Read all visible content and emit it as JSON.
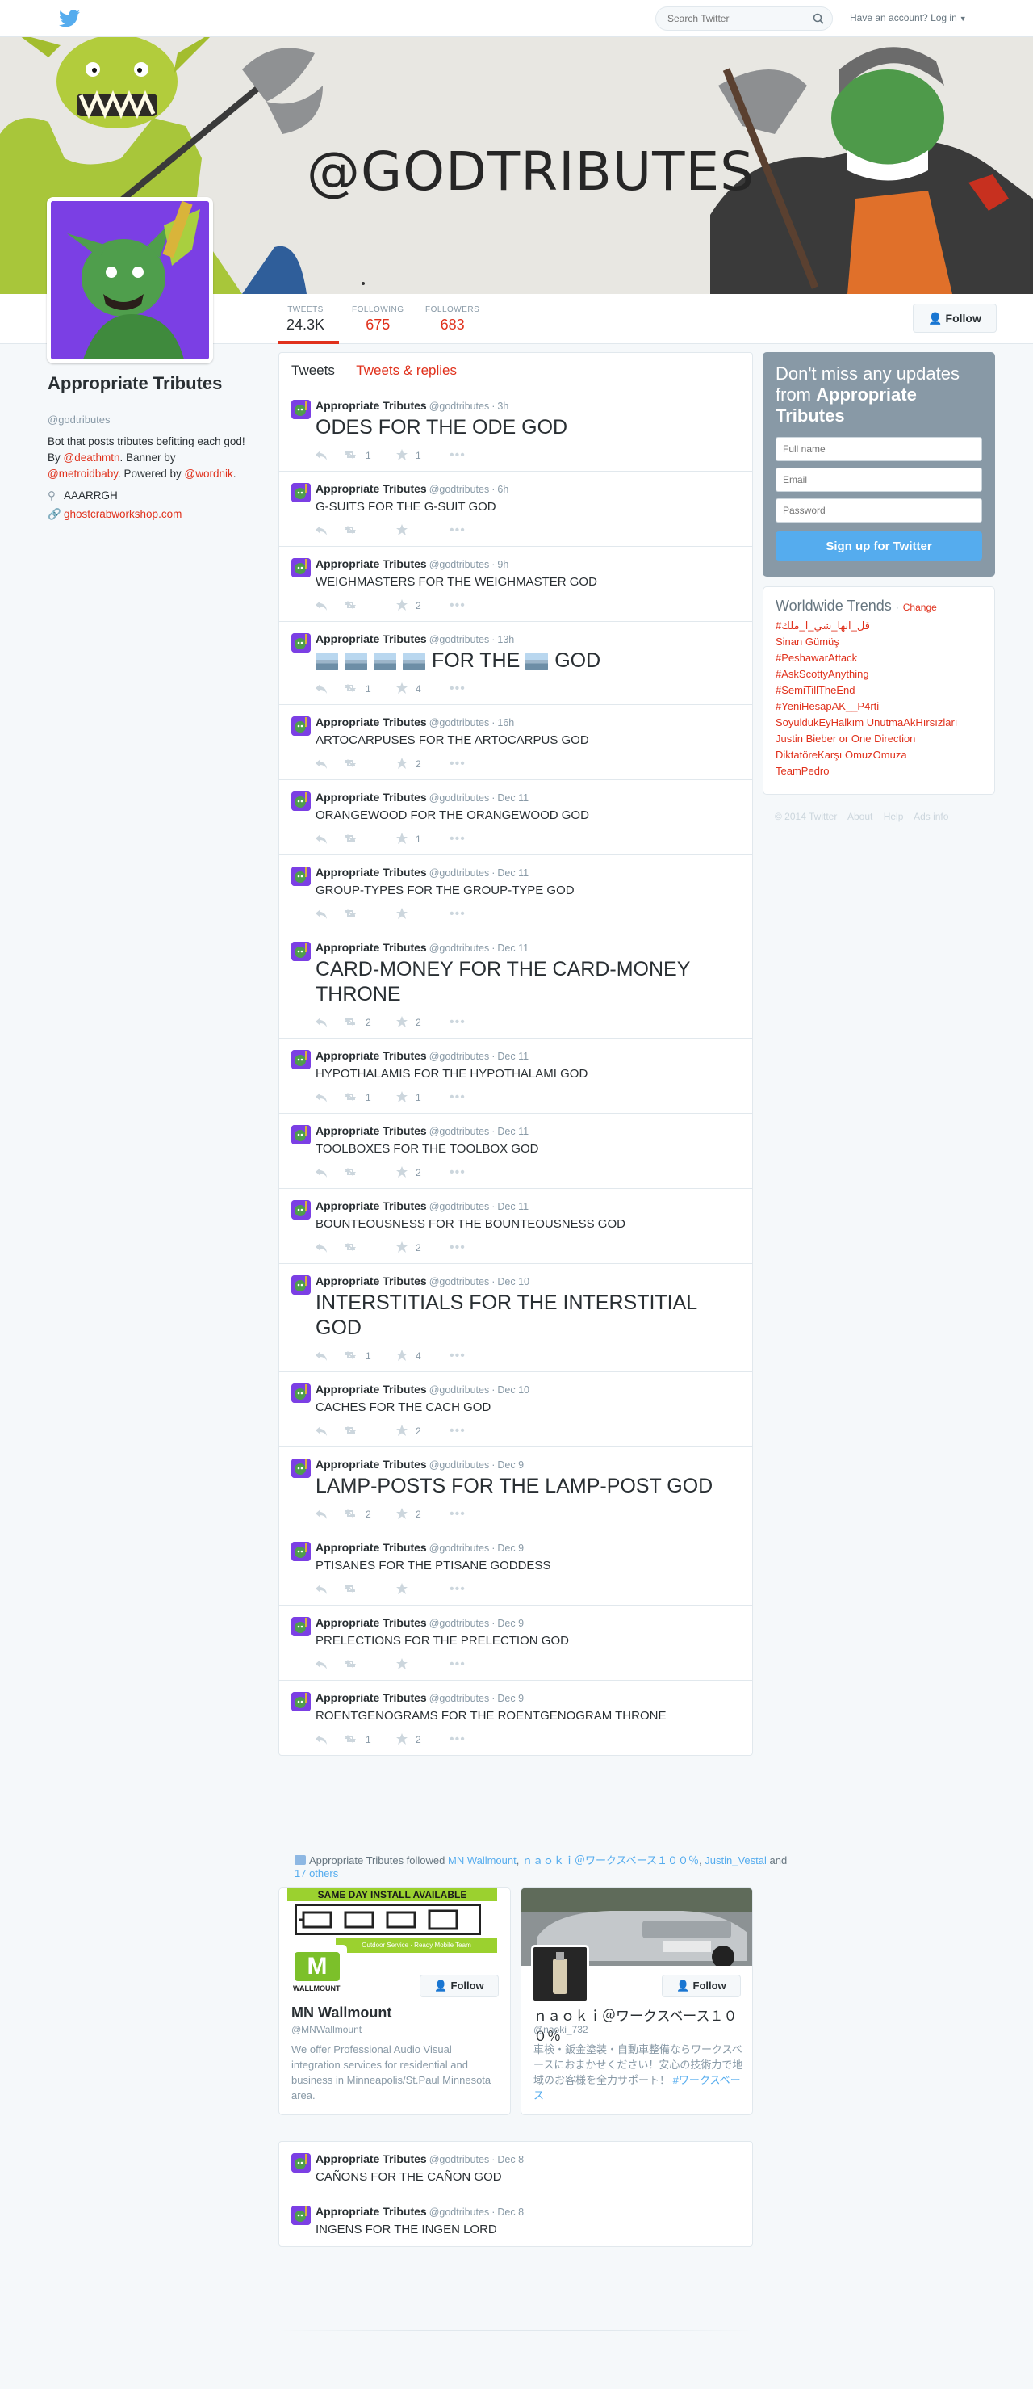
{
  "topbar": {
    "search_placeholder": "Search Twitter",
    "login_label": "Have an account? Log in"
  },
  "banner": {
    "text": "@GODTRIBUTES"
  },
  "stats": [
    {
      "label": "TWEETS",
      "value": "24.3K"
    },
    {
      "label": "FOLLOWING",
      "value": "675"
    },
    {
      "label": "FOLLOWERS",
      "value": "683"
    }
  ],
  "follow_label": "Follow",
  "profile": {
    "name": "Appropriate Tributes",
    "handle": "@godtributes",
    "bio_1": "Bot that posts tributes befitting each god! By ",
    "bio_link_1": "@deathmtn",
    "bio_2": ". Banner by ",
    "bio_link_2": "@metroidbaby",
    "bio_3": ". Powered by ",
    "bio_link_3": "@wordnik",
    "bio_4": ".",
    "location": "AAARRGH",
    "website": "ghostcrabworkshop.com"
  },
  "tabs": {
    "tweets": "Tweets",
    "replies": "Tweets & replies"
  },
  "tweets": [
    {
      "name": "Appropriate Tributes",
      "handle": "@godtributes",
      "time": "3h",
      "text": "ODES FOR THE ODE GOD",
      "retweets": "1",
      "favorites": "1"
    },
    {
      "name": "Appropriate Tributes",
      "handle": "@godtributes",
      "time": "6h",
      "text": "G-SUITS FOR THE G-SUIT GOD",
      "retweets": "",
      "favorites": ""
    },
    {
      "name": "Appropriate Tributes",
      "handle": "@godtributes",
      "time": "9h",
      "text": "WEIGHMASTERS FOR THE WEIGHMASTER GOD",
      "retweets": "",
      "favorites": "2"
    },
    {
      "name": "Appropriate Tributes",
      "handle": "@godtributes",
      "time": "13h",
      "text_1": "FOR THE",
      "text_2": "GOD",
      "retweets": "1",
      "favorites": "4"
    },
    {
      "name": "Appropriate Tributes",
      "handle": "@godtributes",
      "time": "16h",
      "text": "ARTOCARPUSES FOR THE ARTOCARPUS GOD",
      "retweets": "",
      "favorites": "2"
    },
    {
      "name": "Appropriate Tributes",
      "handle": "@godtributes",
      "time": "Dec 11",
      "text": "ORANGEWOOD FOR THE ORANGEWOOD GOD",
      "retweets": "",
      "favorites": "1"
    },
    {
      "name": "Appropriate Tributes",
      "handle": "@godtributes",
      "time": "Dec 11",
      "text": "GROUP-TYPES FOR THE GROUP-TYPE GOD",
      "retweets": "",
      "favorites": ""
    },
    {
      "name": "Appropriate Tributes",
      "handle": "@godtributes",
      "time": "Dec 11",
      "text": "CARD-MONEY FOR THE CARD-MONEY THRONE",
      "retweets": "2",
      "favorites": "2"
    },
    {
      "name": "Appropriate Tributes",
      "handle": "@godtributes",
      "time": "Dec 11",
      "text": "HYPOTHALAMIS FOR THE HYPOTHALAMI GOD",
      "retweets": "1",
      "favorites": "1"
    },
    {
      "name": "Appropriate Tributes",
      "handle": "@godtributes",
      "time": "Dec 11",
      "text": "TOOLBOXES FOR THE TOOLBOX GOD",
      "retweets": "",
      "favorites": "2"
    },
    {
      "name": "Appropriate Tributes",
      "handle": "@godtributes",
      "time": "Dec 11",
      "text": "BOUNTEOUSNESS FOR THE BOUNTEOUSNESS GOD",
      "retweets": "",
      "favorites": "2"
    },
    {
      "name": "Appropriate Tributes",
      "handle": "@godtributes",
      "time": "Dec 10",
      "text": "INTERSTITIALS FOR THE INTERSTITIAL GOD",
      "retweets": "1",
      "favorites": "4"
    },
    {
      "name": "Appropriate Tributes",
      "handle": "@godtributes",
      "time": "Dec 10",
      "text": "CACHES FOR THE CACH GOD",
      "retweets": "",
      "favorites": "2"
    },
    {
      "name": "Appropriate Tributes",
      "handle": "@godtributes",
      "time": "Dec 9",
      "text": "LAMP-POSTS FOR THE LAMP-POST GOD",
      "retweets": "2",
      "favorites": "2"
    },
    {
      "name": "Appropriate Tributes",
      "handle": "@godtributes",
      "time": "Dec 9",
      "text": "PTISANES FOR THE PTISANE GODDESS",
      "retweets": "",
      "favorites": ""
    },
    {
      "name": "Appropriate Tributes",
      "handle": "@godtributes",
      "time": "Dec 9",
      "text": "PRELECTIONS FOR THE PRELECTION GOD",
      "retweets": "",
      "favorites": ""
    },
    {
      "name": "Appropriate Tributes",
      "handle": "@godtributes",
      "time": "Dec 9",
      "text": "ROENTGENOGRAMS FOR THE ROENTGENOGRAM THRONE",
      "retweets": "1",
      "favorites": "2"
    }
  ],
  "followed": {
    "prefix": "Appropriate Tributes followed ",
    "user_1": "MN Wallmount",
    "sep_1": ", ",
    "user_2": "ｎａｏｋｉ＠ワークスベース１００％",
    "sep_2": ", ",
    "user_3": "Justin_Vestal",
    "and": " and ",
    "others": "17 others"
  },
  "cards": [
    {
      "banner_text": "SAME DAY INSTALL AVAILABLE",
      "banner_sub": "Outdoor Service · Ready Mobile Team",
      "logo_text": "WALLMOUNT",
      "name": "MN Wallmount",
      "handle": "@MNWallmount",
      "bio": "We offer Professional Audio Visual integration services for residential and business in Minneapolis/St.Paul Minnesota area.",
      "follow": "Follow"
    },
    {
      "name": "ｎａｏｋｉ＠ワークスベース１００％",
      "handle": "@naoki_732",
      "bio": "車検・鈑金塗装・自動車整備ならワークスベースにおまかせください！安心の技術力で地域のお客様を全力サポート！",
      "hashtag": "#ワークスベース",
      "follow": "Follow"
    }
  ],
  "tweets_lower": [
    {
      "name": "Appropriate Tributes",
      "handle": "@godtributes",
      "time": "Dec 8",
      "text": "CAÑONS FOR THE CAÑON GOD"
    },
    {
      "name": "Appropriate Tributes",
      "handle": "@godtributes",
      "time": "Dec 8",
      "text": "INGENS FOR THE INGEN LORD"
    }
  ],
  "signup": {
    "heading_1": "Don't miss any updates from ",
    "heading_name": "Appropriate Tributes",
    "full_name": "Full name",
    "email": "Email",
    "password": "Password",
    "button": "Sign up for Twitter"
  },
  "trends": {
    "title": "Worldwide Trends",
    "change": "Change",
    "items": [
      "#قل_انها_شي_ا_ملك",
      "Sinan Gümüş",
      "#PeshawarAttack",
      "#AskScottyAnything",
      "#SemiTillTheEnd",
      "#YeniHesapAK__P4rti",
      "SoyuldukEyHalkım UnutmaAkHırsızları",
      "Justin Bieber or One Direction",
      "DiktatöreKarşı OmuzOmuza",
      "TeamPedro"
    ]
  },
  "footer": [
    "© 2014 Twitter",
    "About",
    "Help",
    "Ads info"
  ],
  "colors": {
    "link": "#e0311c",
    "accent": "#55acee",
    "signup_bg": "#8899a6"
  }
}
